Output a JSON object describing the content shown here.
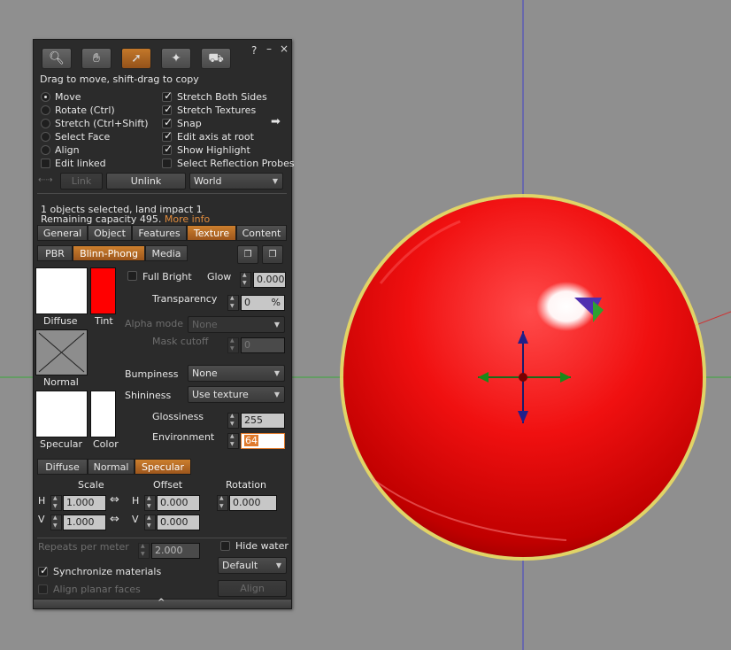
{
  "toolbar": {
    "tools": [
      {
        "name": "focus-tool",
        "icon": "magnifier-icon",
        "active": false
      },
      {
        "name": "move-tool",
        "icon": "hand-icon",
        "active": false
      },
      {
        "name": "edit-tool",
        "icon": "arrow-cursor-icon",
        "active": true
      },
      {
        "name": "create-tool",
        "icon": "magic-wand-icon",
        "active": false
      },
      {
        "name": "land-tool",
        "icon": "bulldozer-icon",
        "active": false
      }
    ],
    "help_label": "?",
    "minimize_label": "–",
    "close_label": "×"
  },
  "hint": "Drag to move, shift-drag to copy",
  "modes": {
    "move": "Move",
    "rotate": "Rotate (Ctrl)",
    "stretch": "Stretch (Ctrl+Shift)",
    "select_face": "Select Face",
    "align": "Align",
    "edit_linked": "Edit linked"
  },
  "options": {
    "stretch_both": "Stretch Both Sides",
    "stretch_textures": "Stretch Textures",
    "snap": "Snap",
    "edit_axis": "Edit axis at root",
    "show_highlight": "Show Highlight",
    "select_probes": "Select Reflection Probes"
  },
  "link_bar": {
    "link": "Link",
    "unlink": "Unlink",
    "ruler": "World"
  },
  "status": {
    "line1": "1 objects selected, land impact 1",
    "line2": "Remaining capacity 495.",
    "more_info": "More info"
  },
  "main_tabs": [
    "General",
    "Object",
    "Features",
    "Texture",
    "Content"
  ],
  "material_tabs": [
    "PBR",
    "Blinn-Phong",
    "Media"
  ],
  "texture": {
    "diffuse_label": "Diffuse",
    "tint_label": "Tint",
    "normal_label": "Normal",
    "specular_label": "Specular",
    "color_label": "Color",
    "tint_color": "#ff0000",
    "full_bright": "Full Bright",
    "glow_label": "Glow",
    "glow_value": "0.000",
    "transparency_label": "Transparency",
    "transparency_value": "0",
    "transparency_unit": "%",
    "alpha_mode_label": "Alpha mode",
    "alpha_mode_value": "None",
    "mask_cutoff_label": "Mask cutoff",
    "mask_cutoff_value": "0",
    "bumpiness_label": "Bumpiness",
    "bumpiness_value": "None",
    "shininess_label": "Shininess",
    "shininess_value": "Use texture",
    "glossiness_label": "Glossiness",
    "glossiness_value": "255",
    "environment_label": "Environment",
    "environment_value": "64"
  },
  "map_tabs": [
    "Diffuse",
    "Normal",
    "Specular"
  ],
  "transform": {
    "scale_label": "Scale",
    "offset_label": "Offset",
    "rotation_label": "Rotation",
    "h_label": "H",
    "v_label": "V",
    "scale_h": "1.000",
    "scale_v": "1.000",
    "offset_h": "0.000",
    "offset_v": "0.000",
    "rotation": "0.000"
  },
  "bottom": {
    "repeats_label": "Repeats per meter",
    "repeats_value": "2.000",
    "hide_water": "Hide water",
    "mapping": "Default",
    "sync_materials": "Synchronize materials",
    "align_planar": "Align planar faces",
    "align_button": "Align",
    "expand_icon": "^"
  },
  "colors": {
    "accent": "#c3782a",
    "object": "#e60000",
    "background": "#8f8f8f"
  }
}
